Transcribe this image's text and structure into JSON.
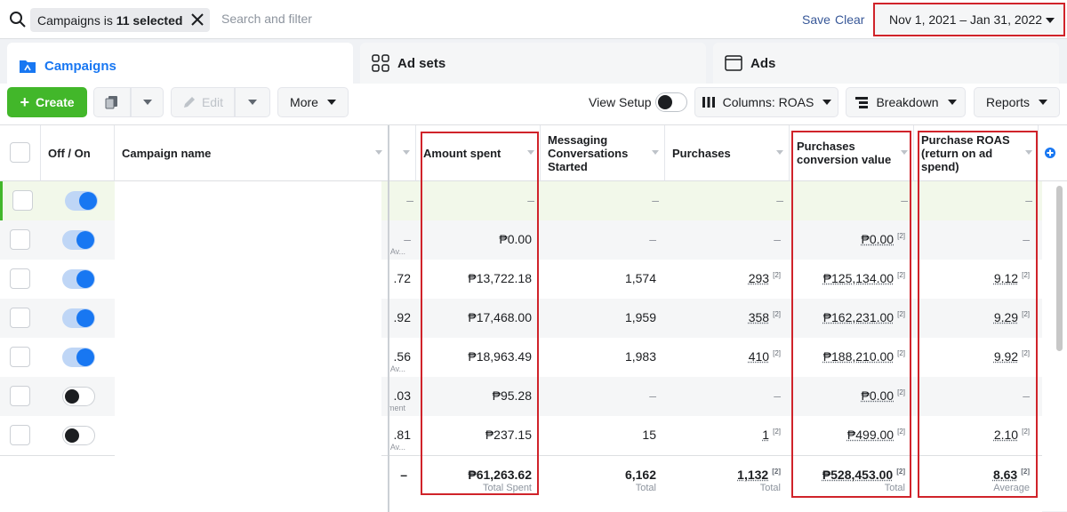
{
  "filter": {
    "chip_prefix": "Campaigns is ",
    "chip_bold": "11 selected",
    "placeholder": "Search and filter",
    "save": "Save",
    "clear": "Clear",
    "date_range": "Nov 1, 2021 – Jan 31, 2022"
  },
  "tabs": {
    "campaigns": "Campaigns",
    "adsets": "Ad sets",
    "ads": "Ads"
  },
  "toolbar": {
    "create": "Create",
    "edit": "Edit",
    "more": "More",
    "view_setup": "View Setup",
    "columns": "Columns: ROAS",
    "breakdown": "Breakdown",
    "reports": "Reports"
  },
  "headers": {
    "onoff": "Off / On",
    "name": "Campaign name",
    "amount": "Amount spent",
    "messaging": "Messaging Conversations Started",
    "purchases": "Purchases",
    "conv_value": "Purchases conversion value",
    "roas": "Purchase ROAS (return on ad spend)"
  },
  "rows": [
    {
      "on": true,
      "clip": "–",
      "clip_sub": "",
      "amount": "–",
      "msg": "–",
      "purch": "–",
      "value": "–",
      "roas": "–"
    },
    {
      "on": true,
      "clip": "–",
      "clip_sub": "Av...",
      "amount": "₱0.00",
      "msg": "–",
      "purch": "–",
      "value": "₱0.00",
      "roas": "–"
    },
    {
      "on": true,
      "clip": ".72",
      "clip_sub": "",
      "amount": "₱13,722.18",
      "msg": "1,574",
      "purch": "293",
      "value": "₱125,134.00",
      "roas": "9.12"
    },
    {
      "on": true,
      "clip": ".92",
      "clip_sub": "",
      "amount": "₱17,468.00",
      "msg": "1,959",
      "purch": "358",
      "value": "₱162,231.00",
      "roas": "9.29"
    },
    {
      "on": true,
      "clip": ".56",
      "clip_sub": "Av...",
      "amount": "₱18,963.49",
      "msg": "1,983",
      "purch": "410",
      "value": "₱188,210.00",
      "roas": "9.92"
    },
    {
      "on": false,
      "clip": ".03",
      "clip_sub": "ment",
      "amount": "₱95.28",
      "msg": "–",
      "purch": "–",
      "value": "₱0.00",
      "roas": "–"
    },
    {
      "on": false,
      "clip": ".81",
      "clip_sub": "Av...",
      "amount": "₱237.15",
      "msg": "15",
      "purch": "1",
      "value": "₱499.00",
      "roas": "2.10"
    }
  ],
  "footnote": "[2]",
  "totals": {
    "clip": "–",
    "amount": "₱61,263.62",
    "amount_label": "Total Spent",
    "msg": "6,162",
    "msg_label": "Total",
    "purch": "1,132",
    "purch_label": "Total",
    "value": "₱528,453.00",
    "value_label": "Total",
    "roas": "8.63",
    "roas_label": "Average"
  },
  "colors": {
    "accent": "#1877f2",
    "create": "#42b72a",
    "highlight_box": "#d0232a"
  }
}
